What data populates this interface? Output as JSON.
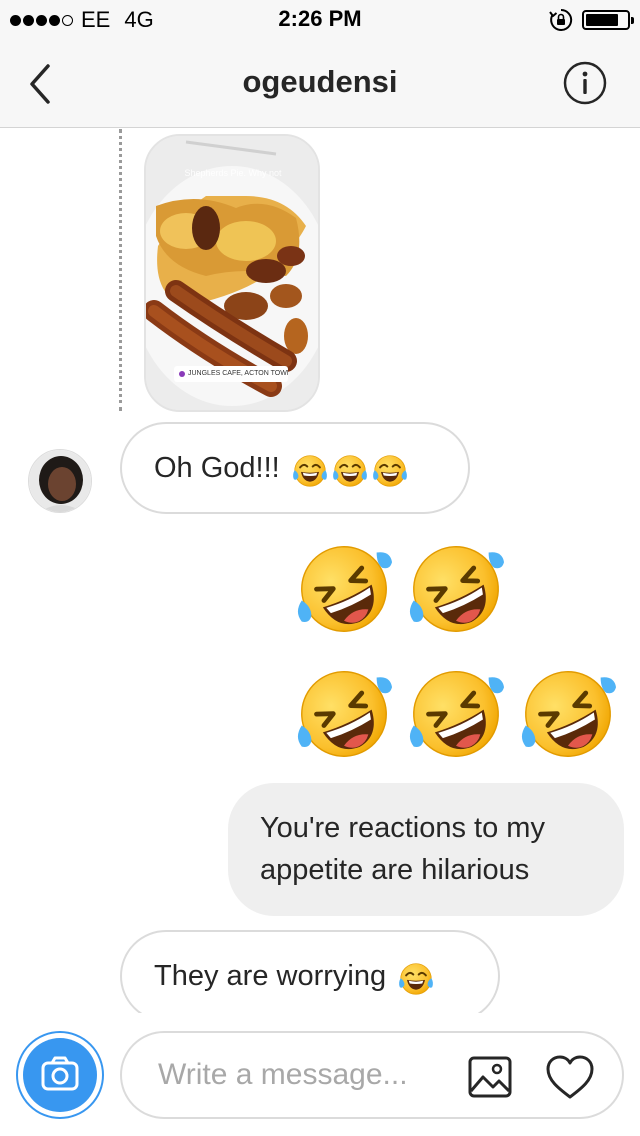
{
  "status_bar": {
    "signal_bars": 4,
    "signal_total": 5,
    "carrier": "EE",
    "network": "4G",
    "time": "2:26 PM",
    "battery_level": 0.8,
    "icons": [
      "rotation-lock-icon",
      "battery-icon"
    ]
  },
  "header": {
    "title": "ogeudensi",
    "icons": [
      "back-chevron-icon",
      "info-icon"
    ]
  },
  "thread": {
    "shared_story": {
      "kind": "story-reply-image",
      "story_caption": "Shepherds Pie. Why not",
      "location_sticker": "JUNGLES CAFE, ACTON TOWN"
    },
    "messages": [
      {
        "from": "ogeudensi",
        "text": "Oh God!!!",
        "emoji": [
          "face-with-tears-of-joy",
          "face-with-tears-of-joy",
          "face-with-tears-of-joy"
        ]
      },
      {
        "from": "me",
        "emoji_only": true,
        "emoji": [
          "rolling-on-floor-laughing",
          "rolling-on-floor-laughing"
        ]
      },
      {
        "from": "me",
        "emoji_only": true,
        "emoji": [
          "rolling-on-floor-laughing",
          "rolling-on-floor-laughing",
          "rolling-on-floor-laughing"
        ]
      },
      {
        "from": "me",
        "text": "You're reactions to my appetite are hilarious"
      },
      {
        "from": "ogeudensi",
        "text": "They are worrying",
        "emoji": [
          "face-with-tears-of-joy"
        ]
      }
    ]
  },
  "composer": {
    "placeholder": "Write a message...",
    "value": "",
    "icons": [
      "camera-icon",
      "gallery-icon",
      "heart-icon"
    ]
  },
  "colors": {
    "accent": "#3897f0",
    "incoming_bubble_border": "#dbdbdb",
    "outgoing_bubble_bg": "#efefef",
    "bar_bg": "#f7f7f7",
    "text": "#262626",
    "placeholder": "#a8a8a8"
  }
}
